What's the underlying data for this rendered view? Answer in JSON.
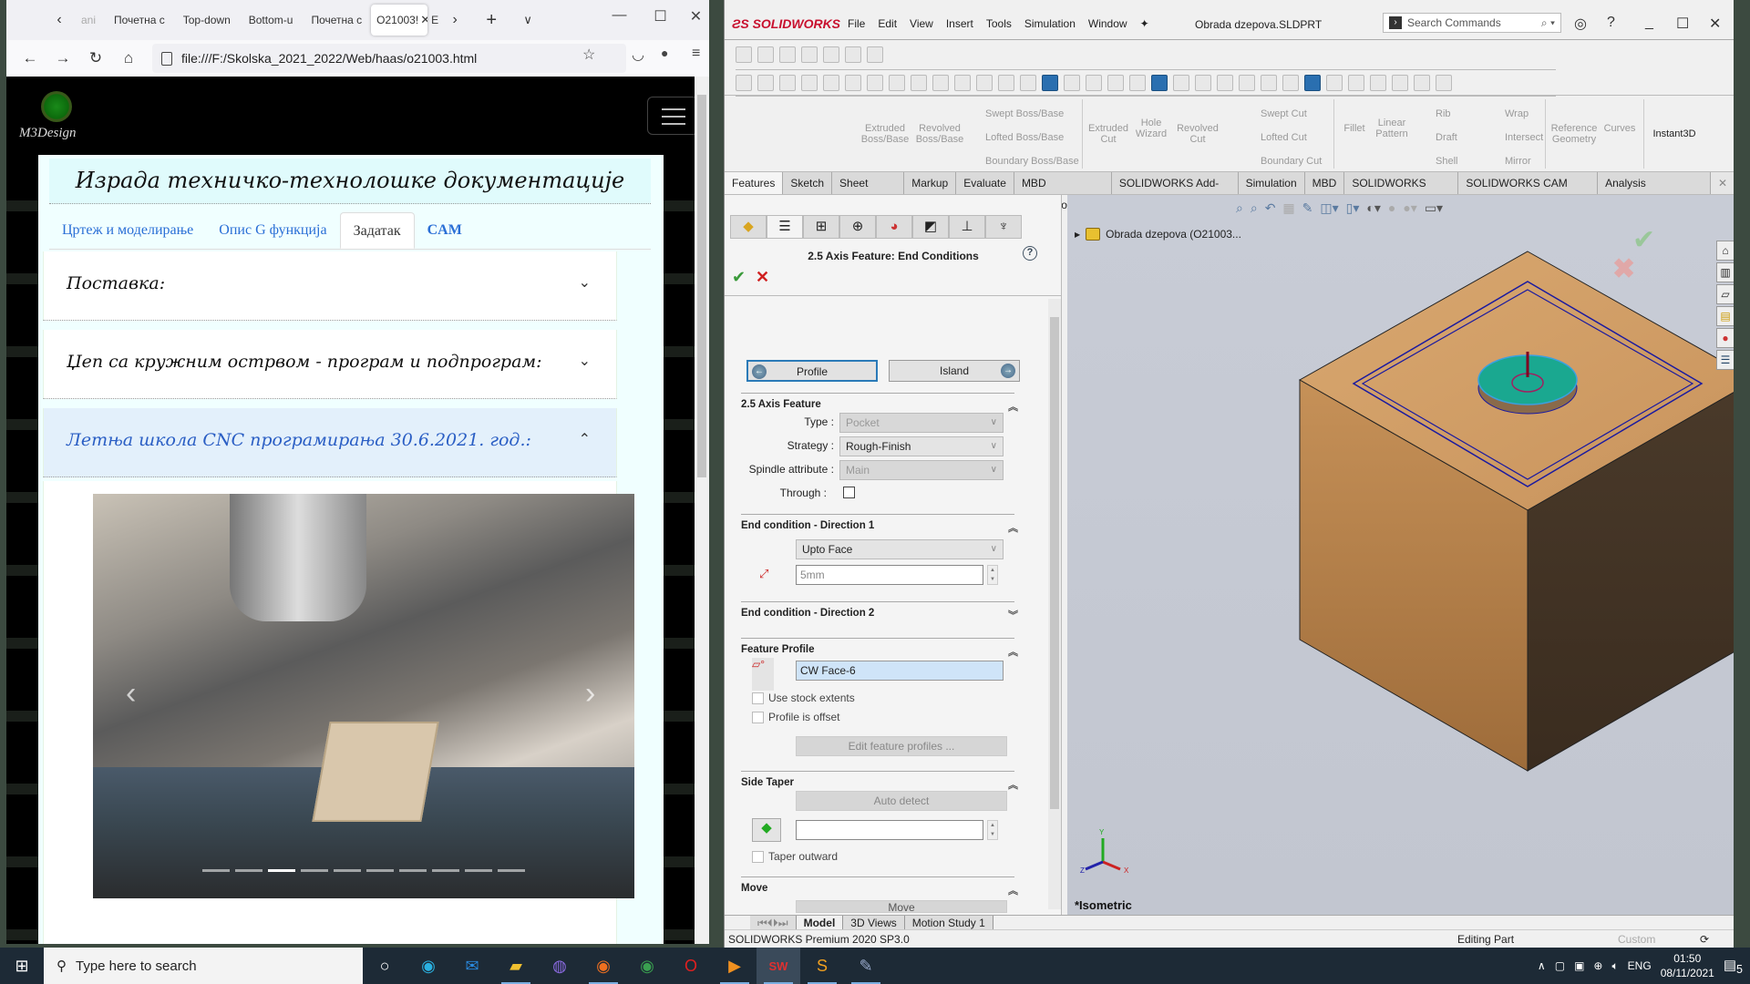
{
  "firefox": {
    "tabs": [
      {
        "label": "ani",
        "active": false
      },
      {
        "label": "Почетна с",
        "active": false
      },
      {
        "label": "Top-down",
        "active": false
      },
      {
        "label": "Bottom-u",
        "active": false
      },
      {
        "label": "Почетна с",
        "active": false
      },
      {
        "label": "O21003!",
        "active": true
      },
      {
        "label": "E",
        "active": false
      }
    ],
    "url": "file:///F:/Skolska_2021_2022/Web/haas/o21003.html",
    "icons": {
      "back": "←",
      "forward": "→",
      "reload": "↻",
      "home": "⌂",
      "star": "☆",
      "pocket": "◡",
      "menu": "≡",
      "new_tab": "+",
      "tab_list": "∨",
      "minimize": "—",
      "maximize": "☐",
      "close": "✕",
      "scroll_left": "‹",
      "scroll_right": "›"
    }
  },
  "site": {
    "logo_text": "M3Design",
    "title": "Израда техничко-технолошке документације",
    "tabs": [
      {
        "label": "Цртеж и моделирање",
        "active": false
      },
      {
        "label": "Опис G функција",
        "active": false
      },
      {
        "label": "Задатак",
        "active": true
      },
      {
        "label": "CAM",
        "active": false
      }
    ],
    "accordion": [
      {
        "label": "Поставка:",
        "open": false,
        "chevron": "⌄"
      },
      {
        "label": "Џеп са кружним острвом - програм и подпрограм:",
        "open": false,
        "chevron": "⌄"
      },
      {
        "label": "Летња школа CNC програмирања 30.6.2021. год.:",
        "open": true,
        "chevron": "⌃"
      }
    ],
    "carousel": {
      "prev": "‹",
      "next": "›",
      "slide_count": 10,
      "active_index": 2
    }
  },
  "solidworks": {
    "brand": "SOLIDWORKS",
    "menu": [
      "File",
      "Edit",
      "View",
      "Insert",
      "Tools",
      "Simulation",
      "Window"
    ],
    "document": "Obrada dzepova.SLDPRT",
    "search_placeholder": "Search Commands",
    "command_manager": {
      "groups": [
        {
          "label": "Extruded Boss/Base"
        },
        {
          "label": "Revolved Boss/Base"
        },
        {
          "label": "Extruded Cut"
        },
        {
          "label": "Hole Wizard"
        },
        {
          "label": "Revolved Cut"
        },
        {
          "label": "Fillet"
        },
        {
          "label": "Linear Pattern"
        },
        {
          "label": "Reference Geometry"
        },
        {
          "label": "Curves"
        },
        {
          "label": "Instant3D"
        }
      ],
      "small": [
        "Swept Boss/Base",
        "Lofted Boss/Base",
        "Boundary Boss/Base",
        "Swept Cut",
        "Lofted Cut",
        "Boundary Cut",
        "Rib",
        "Draft",
        "Shell",
        "Wrap",
        "Intersect",
        "Mirror"
      ],
      "tabs": [
        {
          "label": "Features",
          "active": true
        },
        {
          "label": "Sketch"
        },
        {
          "label": "Sheet Metal"
        },
        {
          "label": "Markup"
        },
        {
          "label": "Evaluate"
        },
        {
          "label": "MBD Dimensions"
        },
        {
          "label": "SOLIDWORKS Add-Ins"
        },
        {
          "label": "Simulation"
        },
        {
          "label": "MBD"
        },
        {
          "label": "SOLIDWORKS CAM"
        },
        {
          "label": "SOLIDWORKS CAM TBM"
        },
        {
          "label": "Analysis Preparation"
        }
      ]
    },
    "property_manager": {
      "title": "2.5 Axis Feature: End Conditions",
      "profile_button": "Profile",
      "island_button": "Island",
      "axis_feature": {
        "header": "2.5 Axis Feature",
        "type_label": "Type :",
        "type_value": "Pocket",
        "strategy_label": "Strategy :",
        "strategy_value": "Rough-Finish",
        "spindle_label": "Spindle attribute :",
        "spindle_value": "Main",
        "through_label": "Through :",
        "through_checked": false
      },
      "direction1": {
        "header": "End condition - Direction 1",
        "condition": "Upto Face",
        "depth": "5mm"
      },
      "direction2": {
        "header": "End condition - Direction 2"
      },
      "feature_profile": {
        "header": "Feature Profile",
        "value": "CW Face-6",
        "use_stock_extents": "Use stock extents",
        "profile_is_offset": "Profile is offset",
        "edit_button": "Edit feature profiles ..."
      },
      "side_taper": {
        "header": "Side Taper",
        "auto_detect": "Auto detect",
        "value": "",
        "taper_outward": "Taper outward"
      },
      "move": {
        "header": "Move",
        "button": "Move"
      }
    },
    "graphics": {
      "tree_root": "Obrada dzepova  (O21003...",
      "view_label": "*Isometric",
      "triad": {
        "x": "X",
        "y": "Y",
        "z": "Z"
      }
    },
    "bottom_tabs": [
      {
        "label": "Model",
        "active": true
      },
      {
        "label": "3D Views"
      },
      {
        "label": "Motion Study 1"
      }
    ],
    "status": {
      "version": "SOLIDWORKS Premium 2020 SP3.0",
      "mode": "Editing Part",
      "units": "Custom"
    }
  },
  "taskbar": {
    "search_placeholder": "Type here to search",
    "apps": [
      "task-view",
      "edge",
      "mail",
      "file-explorer",
      "viber",
      "firefox",
      "chrome",
      "opera",
      "media-player",
      "solidworks",
      "sublime-text",
      "paint"
    ],
    "language": "ENG",
    "time": "01:50",
    "date": "08/11/2021",
    "notifications": "5"
  }
}
